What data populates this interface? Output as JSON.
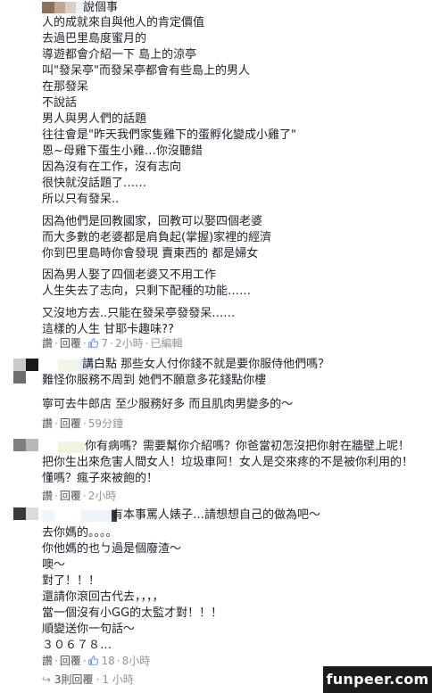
{
  "comments": [
    {
      "author_fragment": "說個事",
      "lines": [
        "人的成就來自與他人的肯定價值",
        "去過巴里島度蜜月的",
        "導遊都會介紹一下 島上的涼亭",
        "叫\"發呆亭\"而發呆亭都會有些島上的男人",
        "在那發呆",
        "不說話",
        "男人與男人們的話題",
        "往往會是\"昨天我們家隻雞下的蛋孵化變成小雞了\"",
        "恩~母雞下蛋生小雞…你沒聽錯",
        "因為沒有在工作，沒有志向",
        "很快就沒話題了……",
        "所以只有發呆..",
        "因為他們是回教國家，回教可以娶四個老婆",
        "而大多數的老婆都是肩負起(掌握)家裡的經濟",
        "你到巴里島時你會發現 賣東西的 都是婦女",
        "因為男人娶了四個老婆又不用工作",
        "人生失去了志向，只剩下配種的功能……",
        "又沒地方去..只能在發呆亭發發呆……",
        "這樣的人生 甘耶卡趣味??"
      ],
      "actions": {
        "reply": "讚",
        "reply2": "回覆",
        "likes": "7",
        "time": "2小時",
        "edited": "已編輯"
      }
    },
    {
      "author_fragment": "講白點 那些女人付你錢不就是要你服侍他們嗎？",
      "lines": [
        "難怪你服務不周到 她們不願意多花錢點你樓",
        "寧可去牛郎店 至少服務好多 而且肌肉男變多的～"
      ],
      "actions": {
        "reply": "讚",
        "reply2": "回覆",
        "time": "59分鐘"
      }
    },
    {
      "author_fragment": "你有病嗎？需要幫你介紹嗎？你爸當初怎沒把你射在牆壁上呢！",
      "lines": [
        "把你生出來危害人間女人！垃圾車阿！女人是交來疼的不是被你利用的！",
        "懂嗎？瘋子來被飽的！"
      ],
      "actions": {
        "reply": "讚",
        "reply2": "回覆",
        "time": "2小時"
      }
    },
    {
      "author_fragment": "有本事罵人婊子…請想想自己的做為吧～",
      "lines": [
        "去你媽的。。。。",
        "你他媽的也ㄅ過是個廢渣～",
        "噢～",
        "對了！！！",
        "還請你滾回古代去，，，，",
        "當一個沒有小GG的太監才對！！！",
        "順變送你一句話～",
        "３０６７８…"
      ],
      "actions": {
        "reply": "讚",
        "reply2": "回覆",
        "likes": "18",
        "time": "8小時"
      },
      "replies": {
        "label": "3則回覆",
        "time": "1 小時"
      }
    }
  ],
  "watermark": "funpeer.com",
  "colors": {
    "text": "#1d2129",
    "meta": "#90949c",
    "action": "#4b4f56",
    "like_icon": "#5890ff"
  }
}
